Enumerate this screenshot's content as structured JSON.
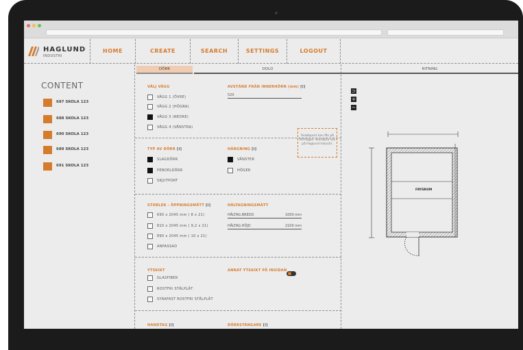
{
  "brand": {
    "name": "HAGLUND",
    "sub": "INDUSTRI"
  },
  "nav": [
    "HOME",
    "CREATE",
    "SEARCH",
    "SETTINGS",
    "LOGOUT"
  ],
  "sidebar": {
    "title": "CONTENT",
    "items": [
      "687 SKOLA 123",
      "688 SKOLA 123",
      "690 SKOLA 123",
      "689 SKOLA 123",
      "691 SKOLA 123"
    ]
  },
  "tabs": {
    "door": "DÖRR",
    "dold": "DOLD",
    "ritning": "RITNING"
  },
  "wall": {
    "heading": "VÄLJ VÄGG",
    "options": [
      {
        "label": "VÄGG 1 (ÖVRE)",
        "checked": false
      },
      {
        "label": "VÄGG 2 (HÖGRA)",
        "checked": false
      },
      {
        "label": "VÄGG 3 (NEDRE)",
        "checked": true
      },
      {
        "label": "VÄGG 4 (VÄNSTRA)",
        "checked": false
      }
    ],
    "distance_heading": "AVSTÅND FRÅN INNERHÖRN (mm)",
    "distance_value": "520"
  },
  "doortype": {
    "heading": "TYP AV DÖRR",
    "options": [
      {
        "label": "SLAGDÖRR",
        "checked": true
      },
      {
        "label": "PENDELDÖRR",
        "checked": true
      },
      {
        "label": "SKJUTPORT",
        "checked": false
      }
    ],
    "hinge_heading": "HÄNGNING",
    "hinge_options": [
      {
        "label": "VÄNSTER",
        "checked": true
      },
      {
        "label": "HÖGER",
        "checked": false
      }
    ],
    "note": "Snabbport kan fås på förfrågan. Kontakta oss på Haglund Industri."
  },
  "size": {
    "heading": "STORLEK - ÖPPNINGSMÅTT",
    "options": [
      {
        "label": "690 x 2045 mm ( 8 x 21)",
        "checked": false
      },
      {
        "label": "810 x 2045 mm ( 9,2 x 21)",
        "checked": false
      },
      {
        "label": "890 x 2045 mm ( 10 x 21)",
        "checked": false
      },
      {
        "label": "ANPASSAD",
        "checked": false
      }
    ],
    "hole_heading": "HÅLTAGNINGSMÅTT",
    "hole_width_label": "HÅLTAG.BREDD",
    "hole_width_value": "1000 mm",
    "hole_height_label": "HÅLTAG.HÖJD",
    "hole_height_value": "2100 mm"
  },
  "finish": {
    "heading": "YTSKIKT",
    "options": [
      {
        "label": "GLASFIBER",
        "checked": false
      },
      {
        "label": "ROSTFRI STÅLPLÅT",
        "checked": false
      },
      {
        "label": "SYRAFAST ROSTFRI STÅLPLÅT",
        "checked": false
      }
    ],
    "inside_heading": "ANNAT YTSKIKT PÅ INSIDAN",
    "inside_toggle": true
  },
  "bottom": {
    "handle_heading": "HANDTAG",
    "bar_heading": "DÖRRSTÄNGARE"
  },
  "drawing": {
    "room_label": "FRYSRUM",
    "zoom": [
      "⊃",
      "+",
      "−"
    ],
    "colors": {
      "accent": "#d57b2c",
      "tab_active": "#f0cdb2"
    }
  }
}
